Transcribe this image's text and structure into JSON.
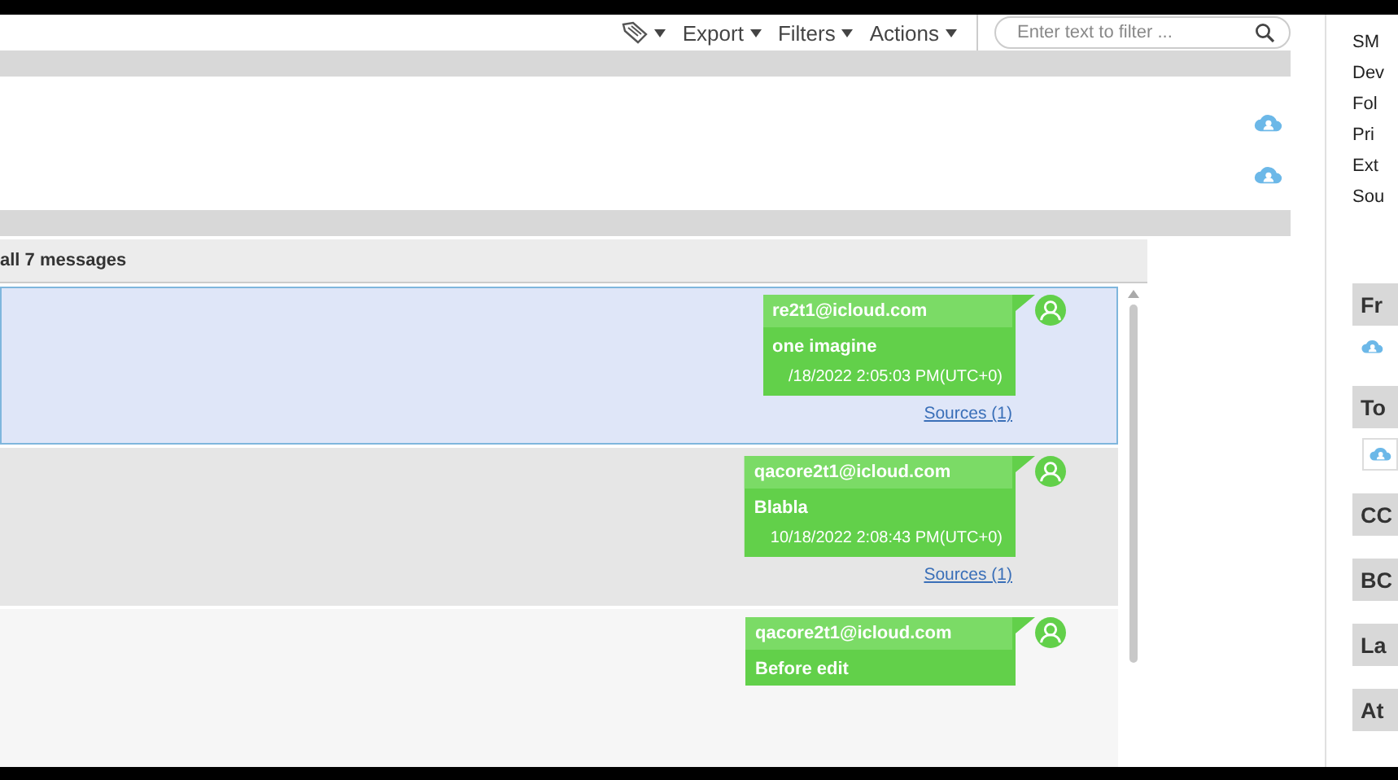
{
  "toolbar": {
    "menus": [
      "Export",
      "Filters",
      "Actions"
    ],
    "search": {
      "placeholder": "Enter text to filter ..."
    }
  },
  "conversation": {
    "header": "all 7 messages",
    "messages": [
      {
        "sender": "re2t1@icloud.com",
        "text": "one imagine",
        "time": "/18/2022 2:05:03 PM(UTC+0)",
        "sources": "Sources (1)",
        "selected": true
      },
      {
        "sender": "qacore2t1@icloud.com",
        "text": "Blabla",
        "time": "10/18/2022 2:08:43 PM(UTC+0)",
        "sources": "Sources (1)",
        "selected": false
      },
      {
        "sender": "qacore2t1@icloud.com",
        "text": "Before edit",
        "selected": false
      }
    ]
  },
  "details": {
    "fields": [
      "SM",
      "Dev",
      "Fol",
      "Pri",
      "Ext",
      "Sou"
    ],
    "sections": [
      {
        "title": "Fr",
        "kind": "cloud"
      },
      {
        "title": "To",
        "kind": "boxed"
      },
      {
        "title": "CC",
        "kind": "plain"
      },
      {
        "title": "BC",
        "kind": "plain"
      },
      {
        "title": "La",
        "kind": "plain"
      },
      {
        "title": "At",
        "kind": "plain"
      }
    ]
  }
}
